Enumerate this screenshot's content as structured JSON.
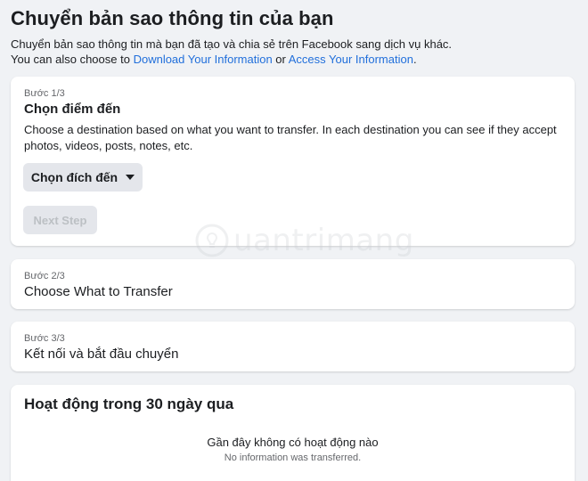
{
  "header": {
    "title": "Chuyển bản sao thông tin của bạn",
    "description_line1": "Chuyển bản sao thông tin mà bạn đã tạo và chia sẻ trên Facebook sang dịch vụ khác.",
    "description_prefix": "You can also choose to ",
    "download_link": "Download Your Information",
    "or_text": " or ",
    "access_link": "Access Your Information",
    "period": "."
  },
  "step1": {
    "label": "Bước 1/3",
    "title": "Chọn điểm đến",
    "description": "Choose a destination based on what you want to transfer. In each destination you can see if they accept photos, videos, posts, notes, etc.",
    "select_label": "Chọn đích đến",
    "next_label": "Next Step"
  },
  "step2": {
    "label": "Bước 2/3",
    "title": "Choose What to Transfer"
  },
  "step3": {
    "label": "Bước 3/3",
    "title": "Kết nối và bắt đầu chuyển"
  },
  "activity": {
    "title": "Hoạt động trong 30 ngày qua",
    "empty_message": "Gần đây không có hoạt động nào",
    "empty_sub": "No information was transferred."
  },
  "watermark": {
    "text": "uantrimang"
  },
  "icons": {
    "dropdown": "caret-down-icon",
    "watermark": "lightbulb-icon"
  },
  "colors": {
    "background": "#f0f2f5",
    "link": "#216fdb",
    "button_bg": "#e4e6eb",
    "disabled_text": "#bcc0c4",
    "secondary_text": "#65676b"
  }
}
